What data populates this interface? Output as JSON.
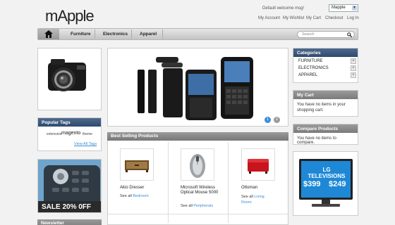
{
  "logo": {
    "text": "mApple"
  },
  "header": {
    "welcome": "Default welcome msg!",
    "store_select": "Mapple",
    "links": [
      "My Account",
      "My Wishlist",
      "My Cart",
      "Checkout",
      "Log In"
    ]
  },
  "nav": {
    "items": [
      "Furniture",
      "Electronics",
      "Apparel"
    ],
    "search_placeholder": "Search"
  },
  "popular_tags": {
    "title": "Popular Tags",
    "tags": [
      "extension",
      "magento",
      "theme"
    ],
    "view_all": "View All Tags"
  },
  "promo": {
    "text": "SALE 20% 0FF"
  },
  "newsletter": {
    "title": "Newsletter"
  },
  "slider": {
    "pages": [
      "1",
      "2"
    ]
  },
  "best_selling": {
    "title": "Best Selling Products",
    "products": [
      {
        "name": "Akio Dresser",
        "see_all": "See all",
        "category": "Bedroom"
      },
      {
        "name": "Microsoft Wireless Optical Mouse 5000",
        "see_all": "See all",
        "category": "Peripherals"
      },
      {
        "name": "Ottoman",
        "see_all": "See all",
        "category": "Living Room"
      }
    ]
  },
  "categories": {
    "title": "Categories",
    "items": [
      "FURNITURE",
      "ELECTRONICS",
      "APPAREL"
    ]
  },
  "cart": {
    "title": "My Cart",
    "text": "You have no items in your shopping cart."
  },
  "compare": {
    "title": "Compare Products",
    "text": "You have no items to compare."
  },
  "tv_ad": {
    "title": "LG TELEVISIONS",
    "price1": "$399",
    "price2": "$249"
  },
  "colors": {
    "accent_blue": "#3b8ed8",
    "header_navy": "#2e4a6e",
    "sale_banner": "#2a2a2a",
    "ottoman_red": "#c8141c"
  }
}
